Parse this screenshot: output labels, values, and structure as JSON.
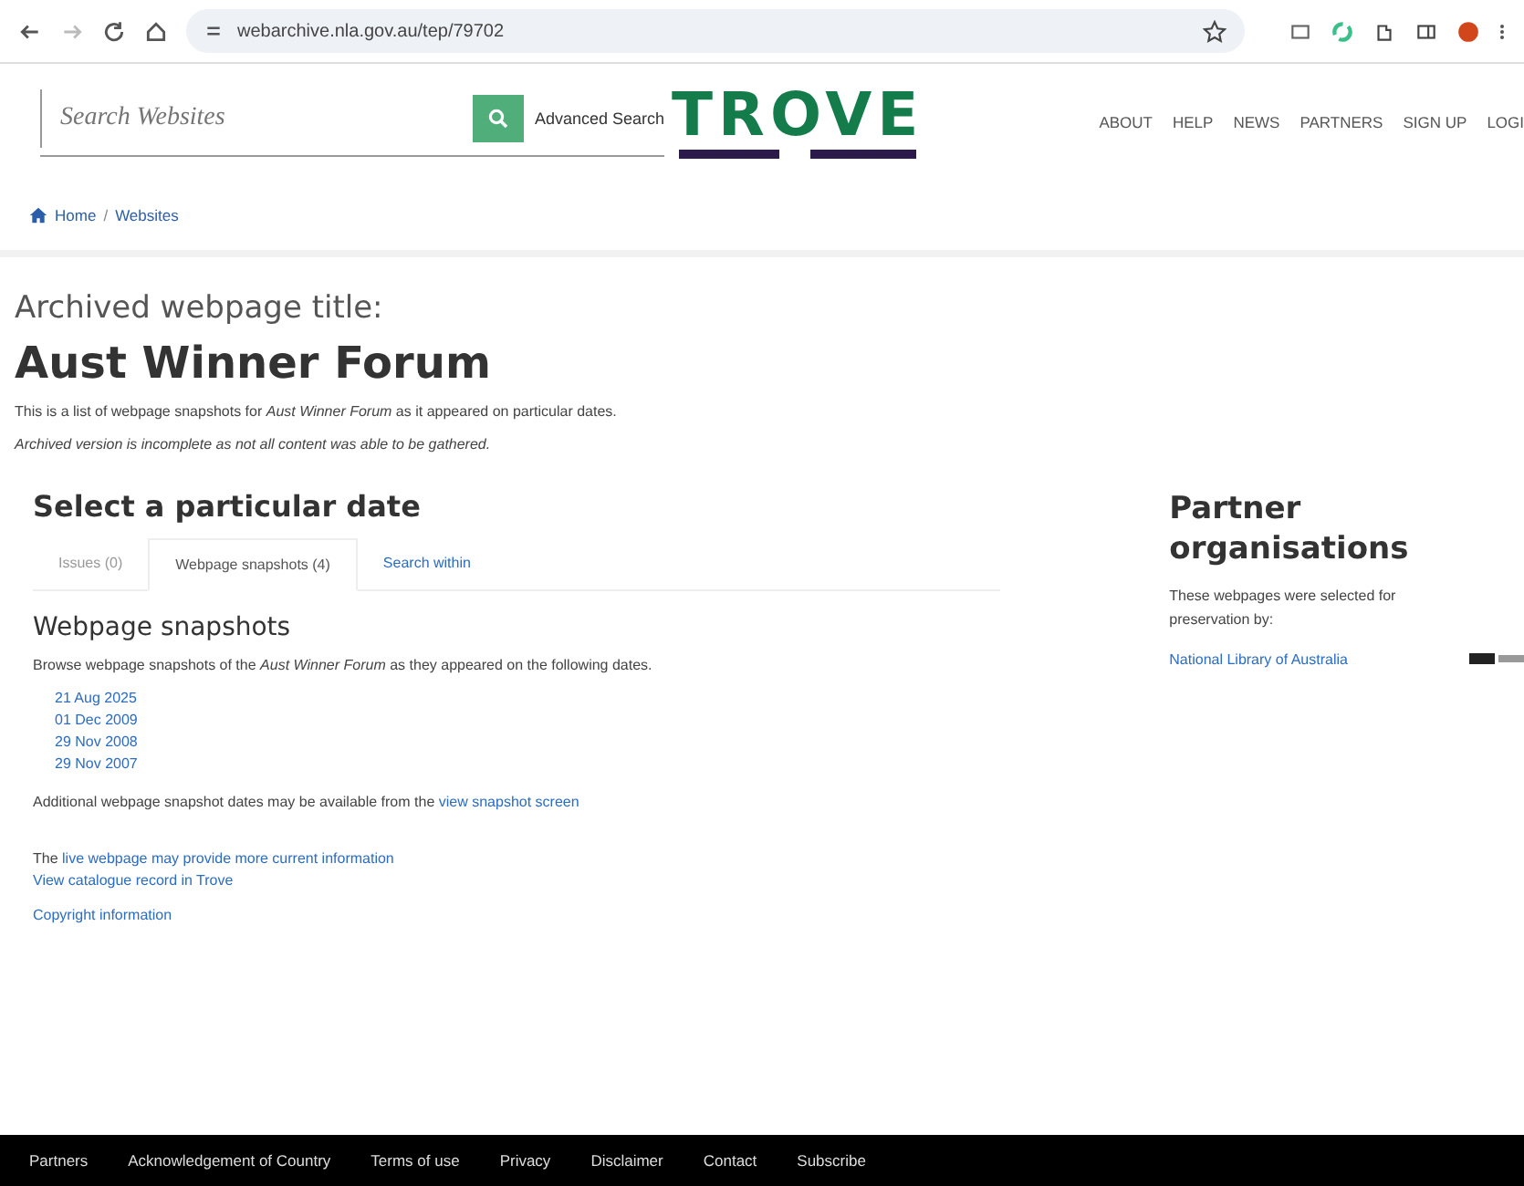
{
  "browser": {
    "url": "webarchive.nla.gov.au/tep/79702"
  },
  "header": {
    "search_placeholder": "Search Websites",
    "advanced_search": "Advanced Search",
    "logo": "TROVE",
    "nav": [
      {
        "label": "ABOUT"
      },
      {
        "label": "HELP"
      },
      {
        "label": "NEWS"
      },
      {
        "label": "PARTNERS"
      },
      {
        "label": "SIGN UP"
      },
      {
        "label": "LOGI"
      }
    ]
  },
  "breadcrumb": {
    "separator": "/",
    "items": [
      "Home",
      "Websites"
    ]
  },
  "title_label": "Archived webpage title:",
  "title": "Aust Winner Forum",
  "intro": "This is a list of webpage snapshots for *Aust Winner Forum* as it appeared on particular dates.",
  "note": "Archived version is incomplete as not all content was able to be gathered.",
  "select_heading": "Select a particular date",
  "tabs": [
    {
      "label": "Issues (0)",
      "selected": false,
      "disabled": true
    },
    {
      "label": "Webpage snapshots (4)",
      "selected": true,
      "disabled": false
    },
    {
      "label": "Search within",
      "selected": false,
      "disabled": false
    }
  ],
  "snapshots": {
    "heading": "Webpage snapshots",
    "intro": "Browse webpage snapshots of the *Aust Winner Forum* as they appeared on the following dates.",
    "dates": [
      "21 Aug 2025",
      "01 Dec 2009",
      "29 Nov 2008",
      "29 Nov 2007"
    ],
    "additional": {
      "text": "Additional webpage snapshot dates may be available from the",
      "link": "view snapshot screen"
    }
  },
  "live": {
    "text": "The",
    "link": "live webpage may provide more current information"
  },
  "catalogue_link": "View catalogue record in Trove",
  "copyright_link": "Copyright information",
  "partners": {
    "heading": "Partner organisations",
    "text": "These webpages were selected for preservation by:",
    "org": "National Library of Australia"
  },
  "footer": [
    "Partners",
    "Acknowledgement of Country",
    "Terms of use",
    "Privacy",
    "Disclaimer",
    "Contact",
    "Subscribe"
  ]
}
